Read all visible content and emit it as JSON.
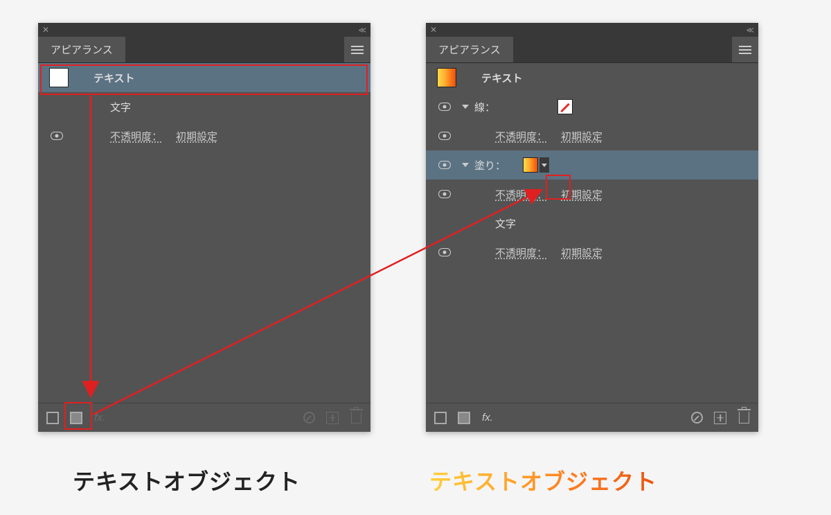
{
  "panel_title": "アピアランス",
  "left": {
    "text_item": "テキスト",
    "char_label": "文字",
    "opacity_label": "不透明度：",
    "opacity_value": "初期設定"
  },
  "right": {
    "text_item": "テキスト",
    "stroke_label": "線：",
    "fill_label": "塗り：",
    "opacity_label": "不透明度：",
    "opacity_value": "初期設定",
    "char_label": "文字"
  },
  "captions": {
    "left": "テキストオブジェクト",
    "right": "テキストオブジェクト"
  },
  "footer": {
    "fx": "fx."
  }
}
